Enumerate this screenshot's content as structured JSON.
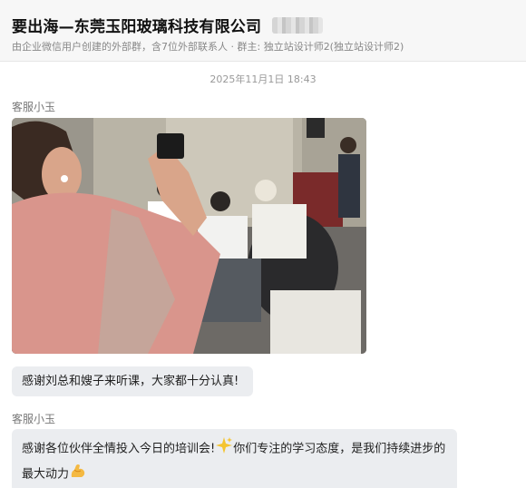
{
  "chat": {
    "title": "要出海—东莞玉阳玻璃科技有限公司",
    "subtitle": "由企业微信用户创建的外部群，含7位外部联系人 · 群主: 独立站设计师2(独立站设计师2)"
  },
  "timestamp": "2025年11月1日 18:43",
  "messages": [
    {
      "sender": "客服小玉",
      "type": "image"
    },
    {
      "text": "感谢刘总和嫂子来听课，大家都十分认真!"
    },
    {
      "sender": "客服小玉",
      "text_part1": "感谢各位伙伴全情投入今日的培训会!",
      "emoji1": "sparkles",
      "text_part2": "你们专注的学习态度，是我们持续进步的最大动力",
      "emoji2": "flexed-biceps"
    }
  ],
  "icons": {
    "sparkles": "sparkles-emoji",
    "muscle": "flexed-biceps-emoji"
  },
  "colors": {
    "header_bg": "#f7f7f7",
    "bubble_bg": "#ebedf0",
    "meta_text": "#888888"
  }
}
